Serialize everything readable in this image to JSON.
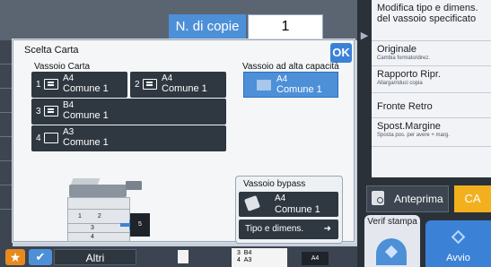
{
  "header": {
    "copies_label": "N. di copie",
    "copies_value": "1"
  },
  "bottom_bar": {
    "altri_label": "Altri",
    "tray_preview_lines": [
      "3",
      "B4",
      "4",
      "A3"
    ],
    "paper_preview_label": "A4"
  },
  "side_panel": {
    "items": [
      {
        "title": "Modifica tipo e dimens. del vassoio specificato",
        "subtitle": ""
      },
      {
        "title": "Originale",
        "subtitle": "Cambia formato/direz."
      },
      {
        "title": "Rapporto Ripr.",
        "subtitle": "Allarga/riduci copia"
      },
      {
        "title": "Fronte Retro",
        "subtitle": ""
      },
      {
        "title": "Spost.Margine",
        "subtitle": "Sposta pos. per avere + marg."
      }
    ],
    "preview_label": "Anteprima",
    "ca_label": "CA",
    "verify_label": "Verif stampa",
    "start_label": "Avvio"
  },
  "dialog": {
    "title": "Scelta Carta",
    "ok_label": "OK",
    "tray_section_label": "Vassoio Carta",
    "trays": [
      {
        "number": "1",
        "size": "A4",
        "type": "Comune 1"
      },
      {
        "number": "2",
        "size": "A4",
        "type": "Comune 1"
      },
      {
        "number": "3",
        "size": "B4",
        "type": "Comune 1"
      },
      {
        "number": "4",
        "size": "A3",
        "type": "Comune 1"
      }
    ],
    "high_capacity": {
      "label": "Vassoio ad alta capacità",
      "size": "A4",
      "type": "Comune 1",
      "selected": true
    },
    "bypass": {
      "label": "Vassoio bypass",
      "size": "A4",
      "type": "Comune 1",
      "type_size_button": "Tipo e dimens."
    },
    "printer_drawers": [
      "1",
      "2",
      "3",
      "4"
    ],
    "printer_bypass_number": "5"
  },
  "colors": {
    "accent_blue": "#4d90d8",
    "dark_button": "#2f3740",
    "ca_yellow": "#f2b01e",
    "favorite_orange": "#e8891d"
  }
}
